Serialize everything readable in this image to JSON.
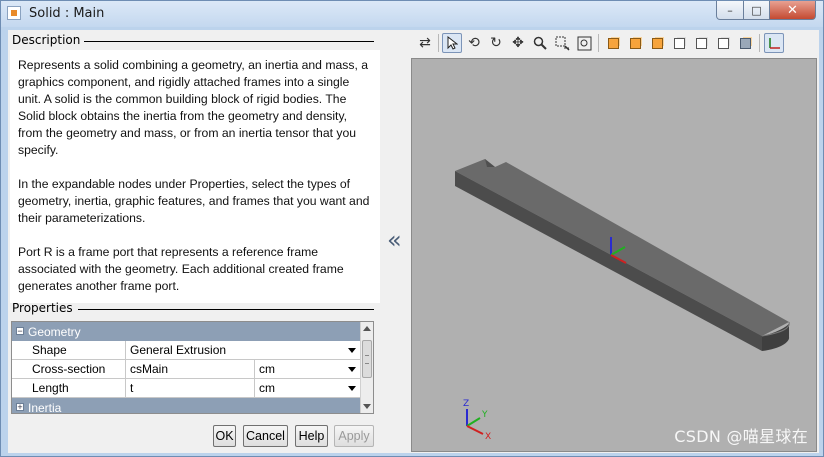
{
  "window": {
    "title": "Solid : Main",
    "controls": {
      "minimize": "–",
      "maximize": "□",
      "close": "✕"
    }
  },
  "description": {
    "heading": "Description",
    "paragraphs": [
      "Represents a solid combining a geometry, an inertia and mass, a graphics component, and rigidly attached frames into a single unit. A solid is the common building block of rigid bodies. The Solid block obtains the inertia from the geometry and density, from the geometry and mass, or from an inertia tensor that you specify.",
      "In the expandable nodes under Properties, select the types of geometry, inertia, graphic features, and frames that you want and their parameterizations.",
      "Port R is a frame port that represents a reference frame associated with the geometry. Each additional created frame generates another frame port."
    ]
  },
  "properties": {
    "heading": "Properties",
    "geometry_group": "Geometry",
    "rows": [
      {
        "name": "Shape",
        "value": "General Extrusion",
        "unit": ""
      },
      {
        "name": "Cross-section",
        "value": "csMain",
        "unit": "cm"
      },
      {
        "name": "Length",
        "value": "t",
        "unit": "cm"
      }
    ],
    "inertia_group": "Inertia"
  },
  "buttons": {
    "ok": "OK",
    "cancel": "Cancel",
    "help": "Help",
    "apply": "Apply"
  },
  "toolbar": {
    "icons": [
      "swap-icon",
      "select-icon",
      "rotate-icon",
      "spin-icon",
      "pan-icon",
      "zoom-icon",
      "zoom-box-icon",
      "fit-icon",
      "front-view-icon",
      "back-view-icon",
      "left-view-icon",
      "right-view-icon",
      "top-view-icon",
      "bottom-view-icon",
      "iso-view-icon",
      "frames-toggle-icon"
    ]
  },
  "viewport": {
    "background": "#b0b0b0",
    "part_color": "#5a5a5a",
    "axis_labels": {
      "x": "X",
      "y": "Y",
      "z": "Z"
    }
  },
  "watermark": "CSDN @喵星球在"
}
